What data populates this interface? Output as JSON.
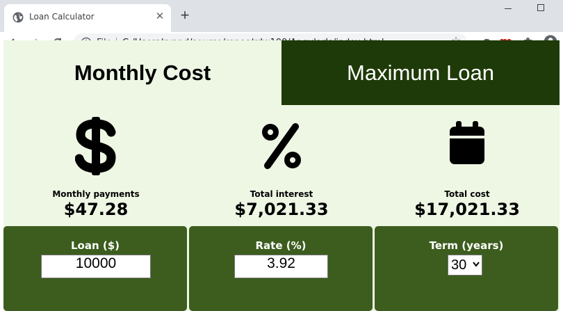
{
  "browser": {
    "tab_title": "Loan Calculator",
    "scheme_label": "File",
    "url": "C:/Users/ryand/source/repos/rdw100/AngularJs/index.html",
    "extension_m_label": "m"
  },
  "app": {
    "tabs": [
      {
        "label": "Monthly Cost",
        "active": true
      },
      {
        "label": "Maximum Loan",
        "active": false
      }
    ],
    "stats": [
      {
        "icon": "dollar-icon",
        "label": "Monthly payments",
        "value": "$47.28"
      },
      {
        "icon": "percent-icon",
        "label": "Total interest",
        "value": "$7,021.33"
      },
      {
        "icon": "calendar-icon",
        "label": "Total cost",
        "value": "$17,021.33"
      }
    ],
    "inputs": {
      "loan": {
        "label": "Loan ($)",
        "value": "10000"
      },
      "rate": {
        "label": "Rate (%)",
        "value": "3.92"
      },
      "term": {
        "label": "Term (years)",
        "value": "30"
      }
    }
  },
  "colors": {
    "page_bg": "#edf7e4",
    "dark_tab_bg": "#1e3a08",
    "panel_bg": "#3c5d1e"
  }
}
